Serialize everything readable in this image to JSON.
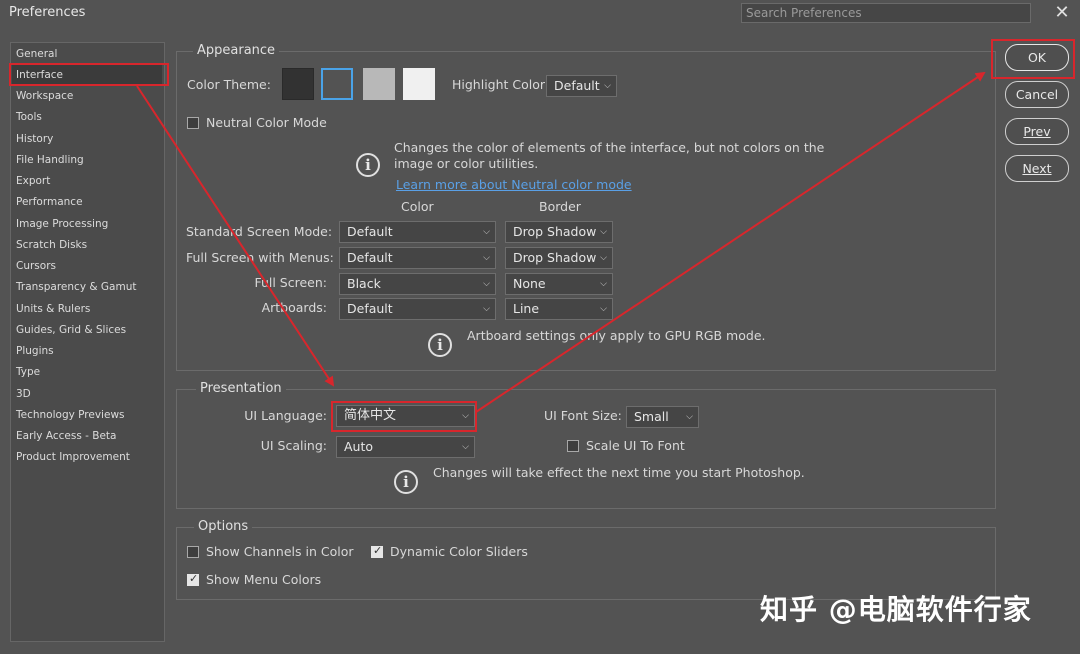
{
  "window": {
    "title": "Preferences",
    "search_placeholder": "Search Preferences"
  },
  "sidebar": {
    "items": [
      "General",
      "Interface",
      "Workspace",
      "Tools",
      "History",
      "File Handling",
      "Export",
      "Performance",
      "Image Processing",
      "Scratch Disks",
      "Cursors",
      "Transparency & Gamut",
      "Units & Rulers",
      "Guides, Grid & Slices",
      "Plugins",
      "Type",
      "3D",
      "Technology Previews",
      "Early Access - Beta",
      "Product Improvement"
    ],
    "selected": "Interface"
  },
  "appearance": {
    "title": "Appearance",
    "color_theme_label": "Color Theme:",
    "highlight_label": "Highlight Color:",
    "highlight_value": "Default",
    "theme_colors": [
      "#323232",
      "#535353",
      "#b8b8b8",
      "#f0f0f0"
    ],
    "neutral_label": "Neutral Color Mode",
    "neutral_info_1": "Changes the color of elements of the interface, but not colors on the",
    "neutral_info_2": "image or color utilities.",
    "neutral_link": "Learn more about Neutral color mode",
    "col_color": "Color",
    "col_border": "Border",
    "rows": [
      {
        "label": "Standard Screen Mode:",
        "color": "Default",
        "border": "Drop Shadow"
      },
      {
        "label": "Full Screen with Menus:",
        "color": "Default",
        "border": "Drop Shadow"
      },
      {
        "label": "Full Screen:",
        "color": "Black",
        "border": "None"
      },
      {
        "label": "Artboards:",
        "color": "Default",
        "border": "Line"
      }
    ],
    "artboard_info": "Artboard settings only apply to GPU RGB mode."
  },
  "presentation": {
    "title": "Presentation",
    "ui_language_label": "UI Language:",
    "ui_language_value": "简体中文",
    "ui_font_size_label": "UI Font Size:",
    "ui_font_size_value": "Small",
    "ui_scaling_label": "UI Scaling:",
    "ui_scaling_value": "Auto",
    "scale_font_label": "Scale UI To Font",
    "info": "Changes will take effect the next time you start Photoshop."
  },
  "options": {
    "title": "Options",
    "show_channels": "Show Channels in Color",
    "dynamic_sliders": "Dynamic Color Sliders",
    "show_menu_colors": "Show Menu Colors"
  },
  "buttons": {
    "ok": "OK",
    "cancel": "Cancel",
    "prev": "Prev",
    "next": "Next"
  },
  "watermark": "知乎 @电脑软件行家",
  "colors": {
    "annotation_red": "#d8262c",
    "link_blue": "#5aa0e6"
  }
}
